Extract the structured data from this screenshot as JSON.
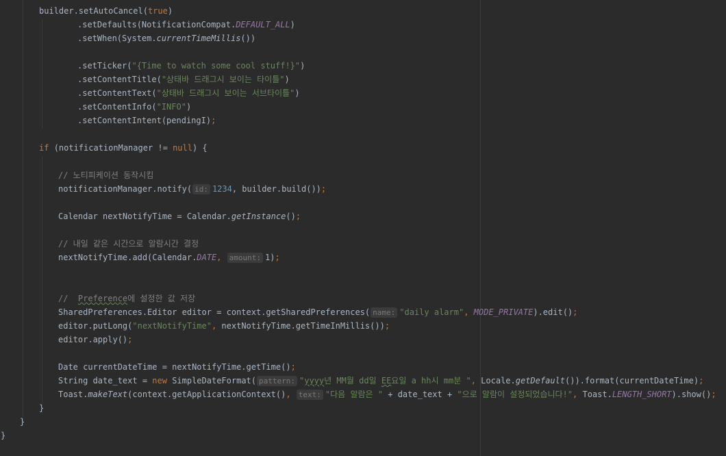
{
  "editor": {
    "lines": [
      {
        "indent": 57,
        "segs": [
          {
            "t": "builder.setAutoCancel(",
            "c": "plain"
          },
          {
            "t": "true",
            "c": "kw"
          },
          {
            "t": ")",
            "c": "plain"
          }
        ]
      },
      {
        "indent": 113,
        "segs": [
          {
            "t": ".setDefaults(NotificationCompat.",
            "c": "plain"
          },
          {
            "t": "DEFAULT_ALL",
            "c": "field"
          },
          {
            "t": ")",
            "c": "plain"
          }
        ]
      },
      {
        "indent": 113,
        "segs": [
          {
            "t": ".setWhen(System.",
            "c": "plain"
          },
          {
            "t": "currentTimeMillis",
            "c": "static"
          },
          {
            "t": "())",
            "c": "plain"
          }
        ]
      },
      {
        "indent": 113,
        "segs": []
      },
      {
        "indent": 113,
        "segs": [
          {
            "t": ".setTicker(",
            "c": "plain"
          },
          {
            "t": "\"{Time to watch some cool stuff!}\"",
            "c": "str"
          },
          {
            "t": ")",
            "c": "plain"
          }
        ]
      },
      {
        "indent": 113,
        "segs": [
          {
            "t": ".setContentTitle(",
            "c": "plain"
          },
          {
            "t": "\"상태바 드래그시 보이는 타이틀\"",
            "c": "str"
          },
          {
            "t": ")",
            "c": "plain"
          }
        ]
      },
      {
        "indent": 113,
        "segs": [
          {
            "t": ".setContentText(",
            "c": "plain"
          },
          {
            "t": "\"상태바 드래그시 보이는 서브타이틀\"",
            "c": "str"
          },
          {
            "t": ")",
            "c": "plain"
          }
        ]
      },
      {
        "indent": 113,
        "segs": [
          {
            "t": ".setContentInfo(",
            "c": "plain"
          },
          {
            "t": "\"INFO\"",
            "c": "str"
          },
          {
            "t": ")",
            "c": "plain"
          }
        ]
      },
      {
        "indent": 113,
        "segs": [
          {
            "t": ".setContentIntent(pendingI)",
            "c": "plain"
          },
          {
            "t": ";",
            "c": "kw"
          }
        ]
      },
      {
        "indent": 57,
        "segs": []
      },
      {
        "indent": 57,
        "segs": [
          {
            "t": "if ",
            "c": "kw"
          },
          {
            "t": "(notificationManager != ",
            "c": "plain"
          },
          {
            "t": "null",
            "c": "kw"
          },
          {
            "t": ") {",
            "c": "plain"
          }
        ]
      },
      {
        "indent": 85,
        "segs": []
      },
      {
        "indent": 85,
        "segs": [
          {
            "t": "// 노티피케이션 동작시킴",
            "c": "cmt"
          }
        ]
      },
      {
        "indent": 85,
        "segs": [
          {
            "t": "notificationManager.notify(",
            "c": "plain"
          },
          {
            "t": "id:",
            "c": "hint"
          },
          {
            "t": "1234",
            "c": "num"
          },
          {
            "t": ", builder.build())",
            "c": "plain"
          },
          {
            "t": ";",
            "c": "kw"
          }
        ]
      },
      {
        "indent": 85,
        "segs": []
      },
      {
        "indent": 85,
        "segs": [
          {
            "t": "Calendar nextNotifyTime = Calendar.",
            "c": "plain"
          },
          {
            "t": "getInstance",
            "c": "static"
          },
          {
            "t": "()",
            "c": "plain"
          },
          {
            "t": ";",
            "c": "kw"
          }
        ]
      },
      {
        "indent": 85,
        "segs": []
      },
      {
        "indent": 85,
        "segs": [
          {
            "t": "// 내일 같은 시간으로 알람시간 결정",
            "c": "cmt"
          }
        ]
      },
      {
        "indent": 85,
        "segs": [
          {
            "t": "nextNotifyTime.add(Calendar.",
            "c": "plain"
          },
          {
            "t": "DATE",
            "c": "field"
          },
          {
            "t": ", ",
            "c": "kw"
          },
          {
            "t": "amount:",
            "c": "hint"
          },
          {
            "t": "1)",
            "c": "plain"
          },
          {
            "t": ";",
            "c": "kw"
          }
        ]
      },
      {
        "indent": 85,
        "segs": []
      },
      {
        "indent": 85,
        "segs": []
      },
      {
        "indent": 85,
        "segs": [
          {
            "t": "//  ",
            "c": "cmt"
          },
          {
            "t": "Preference",
            "c": "cmt underline"
          },
          {
            "t": "에 설정한 값 저장",
            "c": "cmt"
          }
        ]
      },
      {
        "indent": 85,
        "segs": [
          {
            "t": "SharedPreferences.Editor editor = context.getSharedPreferences(",
            "c": "plain"
          },
          {
            "t": "name:",
            "c": "hint"
          },
          {
            "t": "\"daily alarm\"",
            "c": "str"
          },
          {
            "t": ", ",
            "c": "kw"
          },
          {
            "t": "MODE_PRIVATE",
            "c": "field"
          },
          {
            "t": ").edit()",
            "c": "plain"
          },
          {
            "t": ";",
            "c": "kw"
          }
        ]
      },
      {
        "indent": 85,
        "segs": [
          {
            "t": "editor.putLong(",
            "c": "plain"
          },
          {
            "t": "\"nextNotifyTime\"",
            "c": "str"
          },
          {
            "t": ", ",
            "c": "kw"
          },
          {
            "t": "nextNotifyTime.getTimeInMillis())",
            "c": "plain"
          },
          {
            "t": ";",
            "c": "kw"
          }
        ]
      },
      {
        "indent": 85,
        "segs": [
          {
            "t": "editor.apply()",
            "c": "plain"
          },
          {
            "t": ";",
            "c": "kw"
          }
        ]
      },
      {
        "indent": 85,
        "segs": []
      },
      {
        "indent": 85,
        "segs": [
          {
            "t": "Date currentDateTime = nextNotifyTime.getTime()",
            "c": "plain"
          },
          {
            "t": ";",
            "c": "kw"
          }
        ]
      },
      {
        "indent": 85,
        "segs": [
          {
            "t": "String date_text = ",
            "c": "plain"
          },
          {
            "t": "new ",
            "c": "kw"
          },
          {
            "t": "SimpleDateFormat(",
            "c": "plain"
          },
          {
            "t": "pattern:",
            "c": "hint"
          },
          {
            "t": "\"",
            "c": "str"
          },
          {
            "t": "yyyy",
            "c": "str underline"
          },
          {
            "t": "년 MM월 dd일 ",
            "c": "str"
          },
          {
            "t": "EE",
            "c": "str underline"
          },
          {
            "t": "요일 a hh시 mm분 \"",
            "c": "str"
          },
          {
            "t": ", ",
            "c": "kw"
          },
          {
            "t": "Locale.",
            "c": "plain"
          },
          {
            "t": "getDefault",
            "c": "static"
          },
          {
            "t": "()).format(currentDateTime)",
            "c": "plain"
          },
          {
            "t": ";",
            "c": "kw"
          }
        ]
      },
      {
        "indent": 85,
        "segs": [
          {
            "t": "Toast.",
            "c": "plain"
          },
          {
            "t": "makeText",
            "c": "static"
          },
          {
            "t": "(context.getApplicationContext()",
            "c": "plain"
          },
          {
            "t": ", ",
            "c": "kw"
          },
          {
            "t": "text:",
            "c": "hint"
          },
          {
            "t": "\"다음 알람은 \"",
            "c": "str"
          },
          {
            "t": " + date_text + ",
            "c": "plain"
          },
          {
            "t": "\"으로 알람이 설정되었습니다!\"",
            "c": "str"
          },
          {
            "t": ", ",
            "c": "kw"
          },
          {
            "t": "Toast.",
            "c": "plain"
          },
          {
            "t": "LENGTH_SHORT",
            "c": "field"
          },
          {
            "t": ").show()",
            "c": "plain"
          },
          {
            "t": ";",
            "c": "kw"
          }
        ]
      },
      {
        "indent": 57,
        "segs": [
          {
            "t": "}",
            "c": "plain"
          }
        ]
      },
      {
        "indent": 29,
        "segs": [
          {
            "t": "}",
            "c": "plain"
          }
        ]
      },
      {
        "indent": 1,
        "segs": [
          {
            "t": "}",
            "c": "plain"
          }
        ]
      }
    ]
  },
  "colors": {
    "background": "#2b2b2b",
    "keyword": "#cc7832",
    "string": "#6a8759",
    "number": "#6897bb",
    "field": "#9876aa",
    "comment": "#808080",
    "plain": "#a9b7c6"
  }
}
